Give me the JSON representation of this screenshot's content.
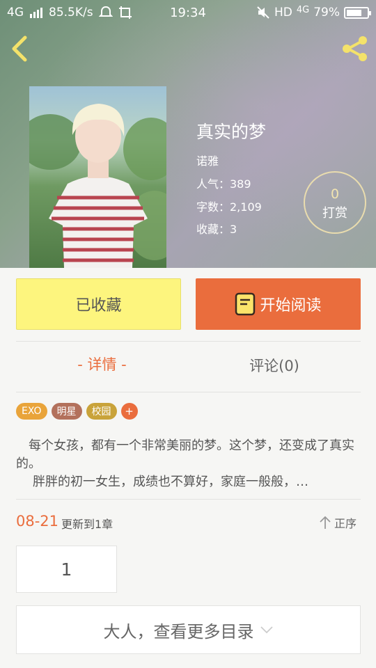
{
  "status_bar": {
    "network": "4G",
    "speed": "85.5K/s",
    "time": "19:34",
    "network2": "HD",
    "network3": "4G",
    "battery": "79%",
    "battery_level": 0.79
  },
  "book": {
    "title": "真实的梦",
    "author": "诺雅",
    "popularity_label": "人气：389",
    "word_count_label": "字数：2,109",
    "favorites_label": "收藏：3"
  },
  "tip": {
    "count": "0",
    "label": "打赏"
  },
  "actions": {
    "collected_label": "已收藏",
    "read_label": "开始阅读"
  },
  "tabs": {
    "detail": "- 详情 -",
    "comments": "评论(0)"
  },
  "tags": [
    {
      "label": "EXO",
      "color": "#e9a43a"
    },
    {
      "label": "明星",
      "color": "#b3715c"
    },
    {
      "label": "校园",
      "color": "#c9a33a"
    }
  ],
  "tag_add": "+",
  "synopsis": {
    "line1": "每个女孩，都有一个非常美丽的梦。这个梦，还变成了真实的。",
    "line2": "胖胖的初一女生，成绩也不算好，家庭一般般，…"
  },
  "update": {
    "date": "08-21",
    "text": "更新到1章",
    "order_label": "正序"
  },
  "chapter": {
    "number": "1"
  },
  "more_catalog": "大人，查看更多目录",
  "colors": {
    "accent": "#ea6d3d",
    "collected_bg": "#fdf57e"
  }
}
